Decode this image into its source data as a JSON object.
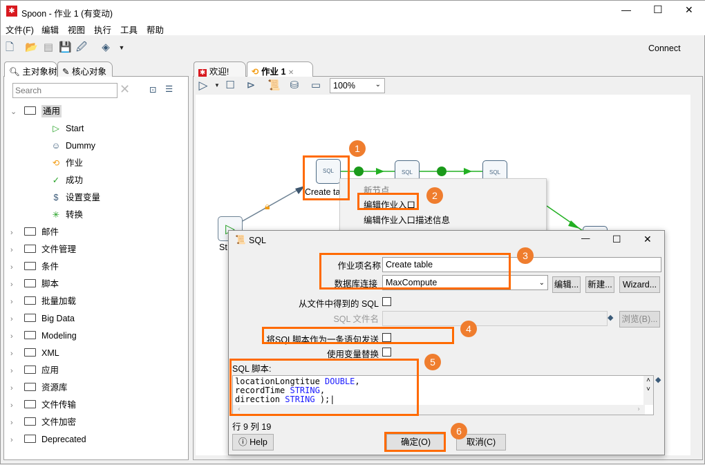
{
  "window": {
    "title": "Spoon - 作业 1 (有变动)",
    "minimize": "—",
    "maximize": "☐",
    "close": "✕"
  },
  "menu": [
    "文件(F)",
    "编辑",
    "视图",
    "执行",
    "工具",
    "帮助"
  ],
  "toolbar": {
    "connect": "Connect"
  },
  "left_panel": {
    "tabs": [
      "主对象树",
      "核心对象"
    ],
    "search_placeholder": "Search",
    "tree": {
      "expanded": "通用",
      "children": [
        {
          "label": "Start",
          "icon": "start-icon"
        },
        {
          "label": "Dummy",
          "icon": "dummy-icon"
        },
        {
          "label": "作业",
          "icon": "job-icon"
        },
        {
          "label": "成功",
          "icon": "success-icon"
        },
        {
          "label": "设置变量",
          "icon": "set-variable-icon"
        },
        {
          "label": "转换",
          "icon": "transformation-icon"
        }
      ],
      "folders": [
        "邮件",
        "文件管理",
        "条件",
        "脚本",
        "批量加载",
        "Big Data",
        "Modeling",
        "XML",
        "应用",
        "资源库",
        "文件传输",
        "文件加密",
        "Deprecated"
      ]
    }
  },
  "editor": {
    "tabs": [
      "欢迎!",
      "作业 1"
    ],
    "zoom": "100%",
    "nodes": {
      "create_table": "Create ta",
      "start": "St"
    },
    "context_menu": {
      "header": "新节点",
      "items": [
        "编辑作业入口",
        "编辑作业入口描述信息"
      ]
    }
  },
  "dialog": {
    "title": "SQL",
    "job_name_label": "作业项名称",
    "job_name_value": "Create table",
    "db_label": "数据库连接",
    "db_value": "MaxCompute",
    "edit_btn": "编辑...",
    "new_btn": "新建...",
    "wizard_btn": "Wizard...",
    "sql_from_file_label": "从文件中得到的 SQL",
    "sql_file_label": "SQL 文件名",
    "browse_btn": "浏览(B)...",
    "send_single_label": "将SQL脚本作为一条语句发送",
    "var_sub_label": "使用变量替换",
    "script_label": "SQL 脚本:",
    "script_lines": [
      {
        "name": "locationLongtitue ",
        "type": "DOUBLE",
        "end": ","
      },
      {
        "name": "recordTime ",
        "type": "STRING",
        "end": ","
      },
      {
        "name": "direction ",
        "type": "STRING",
        "end": " );"
      }
    ],
    "position": "行 9 列 19",
    "help_btn": "Help",
    "ok_btn": "确定(O)",
    "cancel_btn": "取消(C)"
  },
  "annotations": [
    "1",
    "2",
    "3",
    "4",
    "5",
    "6"
  ],
  "colors": {
    "highlight": "#ff6a00",
    "badge": "#ef7d2e",
    "hop": "#22b022",
    "keyword": "#1a1aff"
  }
}
